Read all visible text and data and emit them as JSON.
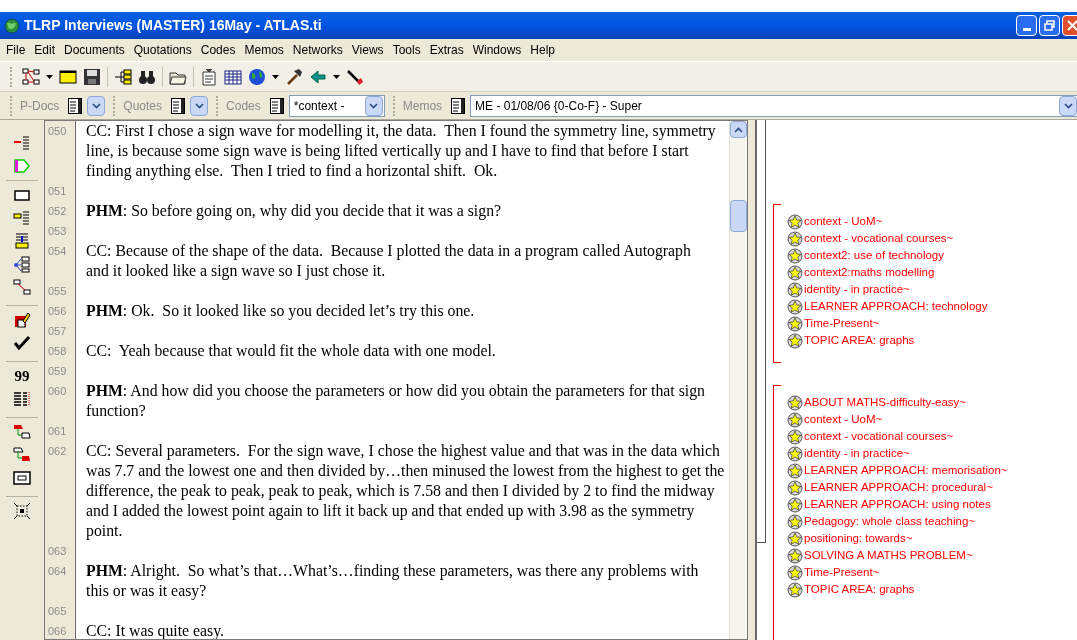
{
  "window": {
    "title": "TLRP Interviews (MASTER) 16May - ATLAS.ti"
  },
  "menu": [
    "File",
    "Edit",
    "Documents",
    "Quotations",
    "Codes",
    "Memos",
    "Networks",
    "Views",
    "Tools",
    "Extras",
    "Windows",
    "Help"
  ],
  "selector_bar": {
    "pdocs_label": "P-Docs",
    "quotes_label": "Quotes",
    "codes_label": "Codes",
    "codes_value": "*context -",
    "memos_label": "Memos",
    "memos_value": "ME - 01/08/06 {0-Co-F} - Super"
  },
  "side_toolbar": {
    "quote_count_glyph": "99"
  },
  "transcript": [
    {
      "number": "050",
      "lines": [
        "CC: First I chose a sign wave for modelling it, the data.  Then I found the symmetry line, symmetry",
        "line, is because some sign wave is being lifted vertically up and I have to find that before I start",
        "finding anything else.  Then I tried to find a horizontal shift.  Ok."
      ]
    },
    {
      "number": "051"
    },
    {
      "number": "052",
      "lines": [
        "**PHM**: So before going on, why did you decide that it was a sign?"
      ]
    },
    {
      "number": "053"
    },
    {
      "number": "054",
      "lines": [
        "CC: Because of the shape of the data.  Because I plotted the data in a program called Autograph",
        "and it looked like a sign wave so I just chose it."
      ]
    },
    {
      "number": "055"
    },
    {
      "number": "056",
      "lines": [
        "**PHM**: Ok.  So it looked like so you decided let’s try this one."
      ]
    },
    {
      "number": "057"
    },
    {
      "number": "058",
      "lines": [
        "CC:  Yeah because that would fit the whole data with one model."
      ]
    },
    {
      "number": "059"
    },
    {
      "number": "060",
      "lines": [
        "**PHM**: And how did you choose the parameters or how did you obtain the parameters for that sign",
        "function?"
      ]
    },
    {
      "number": "061"
    },
    {
      "number": "062",
      "lines": [
        "CC: Several parameters.  For the sign wave, I chose the highest value and that was in the data which",
        "was 7.7 and the lowest one and then divided by…then minused the lowest from the highest to get the",
        "difference, the peak to peak, peak to peak, which is 7.58 and then I divided by 2 to find the midway",
        "and I added the lowest point again to lift it back up and that ended up with 3.98 as the symmetry",
        "point."
      ]
    },
    {
      "number": "063"
    },
    {
      "number": "064",
      "lines": [
        "**PHM**: Alright.  So what’s that…What’s…finding these parameters, was there any problems with",
        "this or was it easy?"
      ]
    },
    {
      "number": "065"
    },
    {
      "number": "066",
      "lines": [
        "CC: It was quite easy."
      ]
    }
  ],
  "margin": {
    "segments": [
      {
        "codes": [
          "context - UoM~",
          "context - vocational courses~",
          "context2: use of technology",
          "context2:maths modelling",
          "identity -  in practice~",
          "LEARNER APPROACH: technology",
          "Time-Present~",
          "TOPIC AREA: graphs"
        ]
      },
      {
        "codes": [
          "ABOUT MATHS-difficulty-easy~",
          "context - UoM~",
          "context - vocational courses~",
          "identity -  in practice~",
          "LEARNER APPROACH: memorisation~",
          "LEARNER APPROACH: procedural~",
          "LEARNER APPROACH: using notes",
          "Pedagogy: whole class teaching~",
          "positioning: towards~",
          "SOLVING A MATHS PROBLEM~",
          "Time-Present~",
          "TOPIC AREA: graphs"
        ]
      }
    ]
  }
}
